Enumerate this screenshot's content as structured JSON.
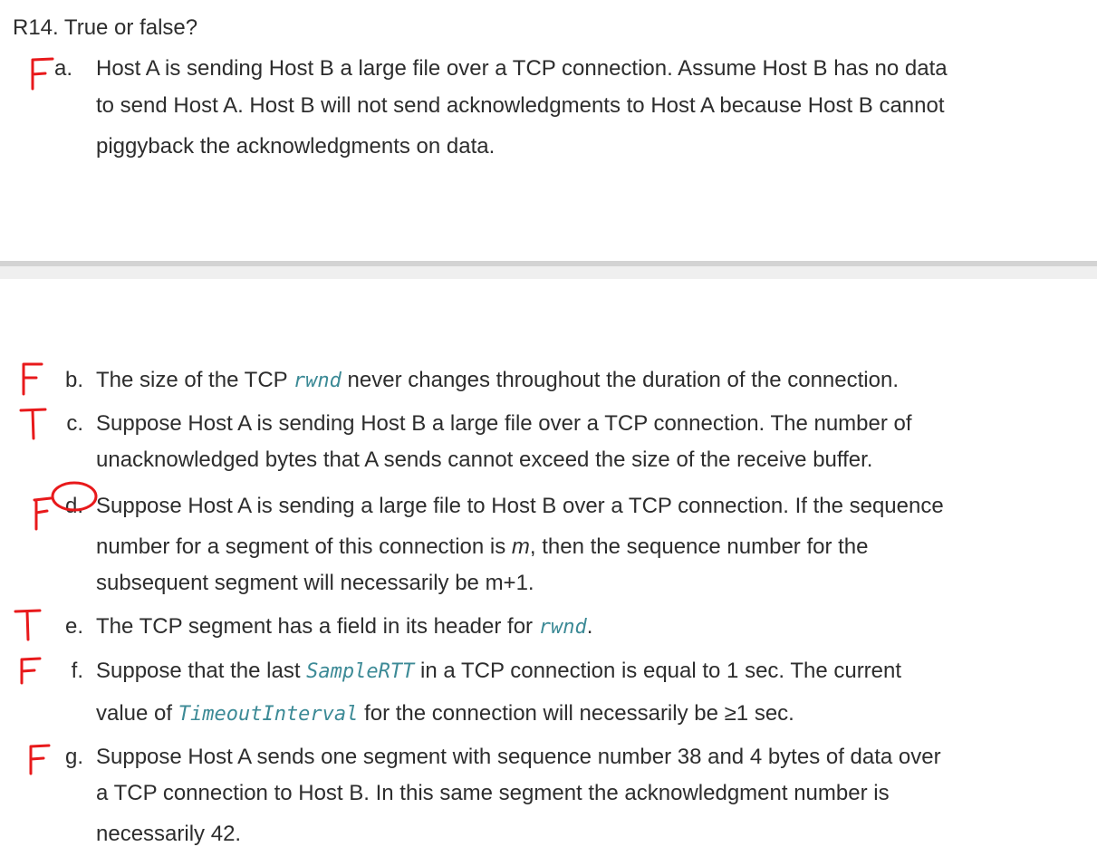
{
  "question": {
    "title": "R14. True or false?",
    "items": [
      {
        "label": "a.",
        "answer": "F",
        "lines": [
          "Host A is sending Host B a large file over a TCP connection. Assume Host B has no data",
          "to send Host A. Host B will not send acknowledgments to Host A because Host B cannot",
          "piggyback the acknowledgments on data."
        ]
      },
      {
        "label": "b.",
        "answer": "F",
        "pre": "The size of the TCP ",
        "code": "rwnd",
        "post": " never changes throughout the duration of the connection."
      },
      {
        "label": "c.",
        "answer": "T",
        "lines": [
          "Suppose Host A is sending Host B a large file over a TCP connection. The number of",
          "unacknowledged bytes that A sends cannot exceed the size of the receive buffer."
        ]
      },
      {
        "label": "d.",
        "answer": "F",
        "line1": "Suppose Host A is sending a large file to Host B over a TCP connection. If the sequence",
        "line2_pre": "number for a segment of this connection is ",
        "line2_var": "m",
        "line2_post": ", then the sequence number for the",
        "line3": "subsequent segment will necessarily be m+1."
      },
      {
        "label": "e.",
        "answer": "T",
        "pre": "The TCP segment has a field in its header for ",
        "code": "rwnd",
        "post": "."
      },
      {
        "label": "f.",
        "answer": "F",
        "line1_pre": "Suppose that the last ",
        "line1_code": "SampleRTT",
        "line1_post": " in a TCP connection is equal to 1 sec. The current",
        "line2_pre": "value of ",
        "line2_code": "TimeoutInterval",
        "line2_post": " for the connection will necessarily be ≥1 sec."
      },
      {
        "label": "g.",
        "answer": "F",
        "lines": [
          "Suppose Host A sends one segment with sequence number 38 and 4 bytes of data over",
          "a TCP connection to Host B. In this same segment the acknowledgment number is",
          "necessarily 42."
        ]
      }
    ]
  },
  "colors": {
    "text": "#2d2d2d",
    "code": "#3c8a96",
    "handwriting": "#e8191b",
    "divider": "#d3d3d3"
  }
}
